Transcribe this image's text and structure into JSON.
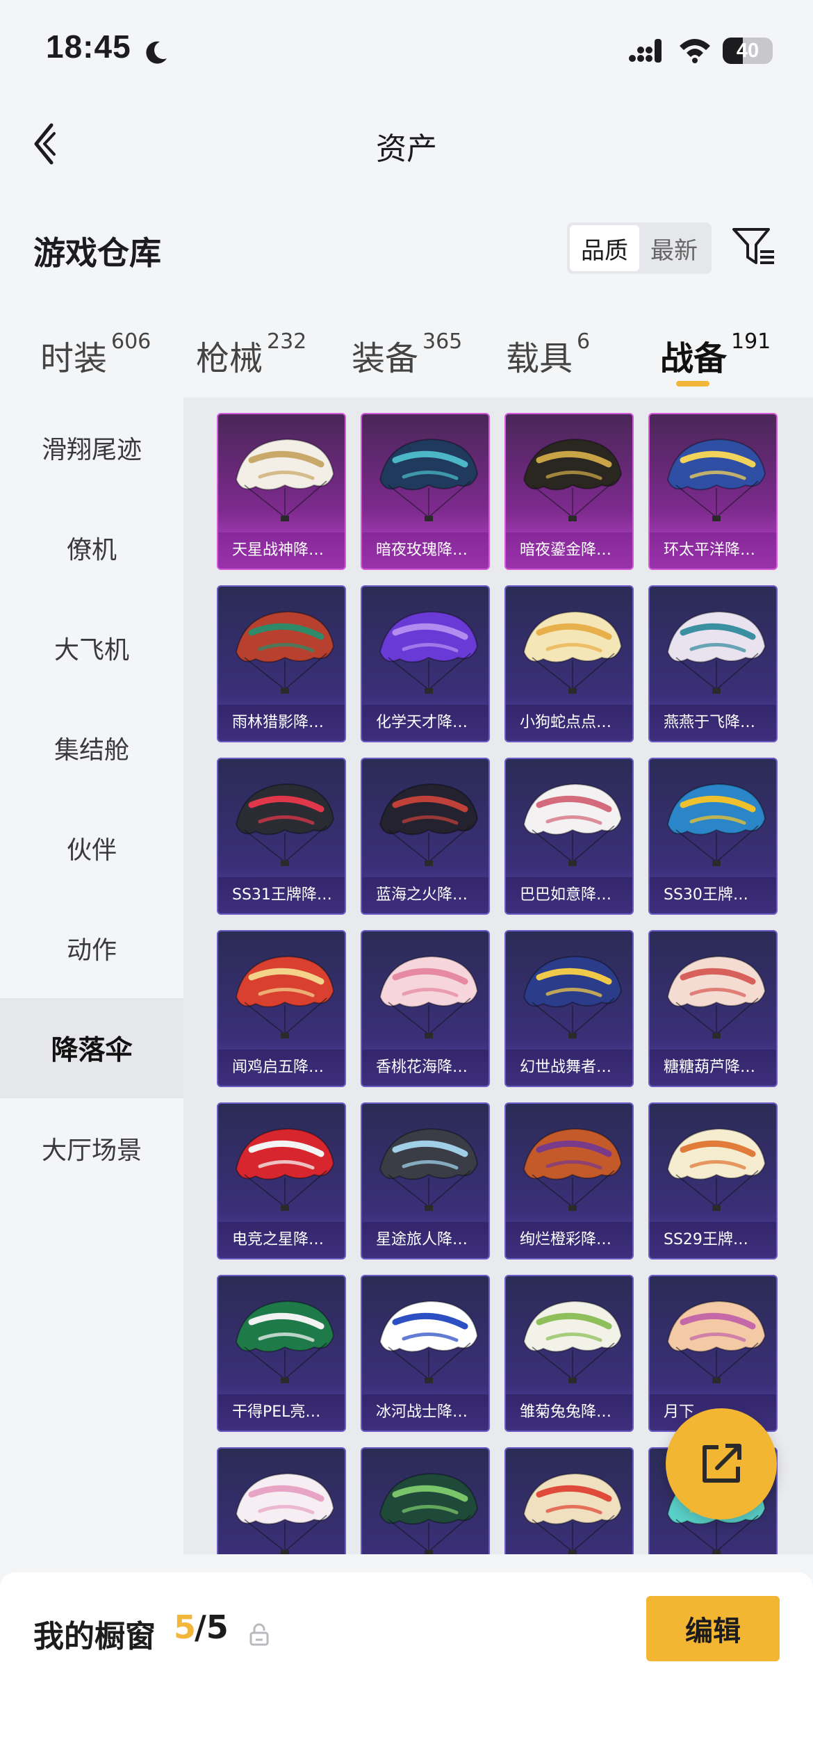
{
  "status_bar": {
    "time": "18:45",
    "battery": "40",
    "battery_level": 0.4,
    "icons": [
      "moon-icon",
      "signal-icon",
      "wifi-icon",
      "battery-icon"
    ]
  },
  "nav": {
    "title": "资产",
    "back_icon": "chevron-left-icon"
  },
  "header": {
    "heading": "游戏仓库",
    "sort_options": [
      "品质",
      "最新"
    ],
    "sort_selected": "品质",
    "filter_icon": "filter-icon"
  },
  "tabs": [
    {
      "label": "时装",
      "count": "606"
    },
    {
      "label": "枪械",
      "count": "232"
    },
    {
      "label": "装备",
      "count": "365"
    },
    {
      "label": "载具",
      "count": "6"
    },
    {
      "label": "战备",
      "count": "191",
      "active": true
    }
  ],
  "sidebar": {
    "items": [
      {
        "label": "滑翔尾迹"
      },
      {
        "label": "僚机"
      },
      {
        "label": "大飞机"
      },
      {
        "label": "集结舱"
      },
      {
        "label": "伙伴"
      },
      {
        "label": "动作"
      },
      {
        "label": "降落伞",
        "active": true
      },
      {
        "label": "大厅场景"
      }
    ]
  },
  "grid": {
    "items": [
      {
        "name": "天星战神降…",
        "rarity": "legendary",
        "colors": [
          "#f3efe6",
          "#c9a96a"
        ]
      },
      {
        "name": "暗夜玫瑰降…",
        "rarity": "legendary",
        "colors": [
          "#1f3a5c",
          "#4bb7c7"
        ]
      },
      {
        "name": "暗夜鎏金降…",
        "rarity": "legendary",
        "colors": [
          "#2a2620",
          "#c9a447"
        ]
      },
      {
        "name": "环太平洋降…",
        "rarity": "legendary",
        "colors": [
          "#2e4fa3",
          "#f1d25a"
        ]
      },
      {
        "name": "雨林猎影降…",
        "rarity": "epic",
        "colors": [
          "#b8402e",
          "#2f8a6a"
        ]
      },
      {
        "name": "化学天才降…",
        "rarity": "epic",
        "colors": [
          "#6a3ad6",
          "#b48cf0"
        ]
      },
      {
        "name": "小狗蛇点点…",
        "rarity": "epic",
        "colors": [
          "#f5e6b8",
          "#e8b04a"
        ]
      },
      {
        "name": "燕燕于飞降…",
        "rarity": "epic",
        "colors": [
          "#e9e2ef",
          "#3a8fa0"
        ]
      },
      {
        "name": "SS31王牌降…",
        "rarity": "epic",
        "colors": [
          "#2b2b33",
          "#e0384a"
        ]
      },
      {
        "name": "蓝海之火降…",
        "rarity": "epic",
        "colors": [
          "#23222e",
          "#c0403a"
        ]
      },
      {
        "name": "巴巴如意降…",
        "rarity": "epic",
        "colors": [
          "#f4f1f2",
          "#d46b7c"
        ]
      },
      {
        "name": "SS30王牌…",
        "rarity": "epic",
        "colors": [
          "#2a86c8",
          "#f0c12e"
        ]
      },
      {
        "name": "闻鸡启五降…",
        "rarity": "epic",
        "colors": [
          "#d9402f",
          "#f3d28a"
        ]
      },
      {
        "name": "香桃花海降…",
        "rarity": "epic",
        "colors": [
          "#f6d6dc",
          "#e58aa0"
        ]
      },
      {
        "name": "幻世战舞者…",
        "rarity": "epic",
        "colors": [
          "#2b3d8a",
          "#f0c84a"
        ]
      },
      {
        "name": "糖糖葫芦降…",
        "rarity": "epic",
        "colors": [
          "#f5dcd3",
          "#d8605a"
        ]
      },
      {
        "name": "电竞之星降…",
        "rarity": "epic",
        "colors": [
          "#d8262e",
          "#f4f4f4"
        ]
      },
      {
        "name": "星途旅人降…",
        "rarity": "epic",
        "colors": [
          "#3a3d46",
          "#9fd0e8"
        ]
      },
      {
        "name": "绚烂橙彩降…",
        "rarity": "epic",
        "colors": [
          "#c45a2a",
          "#7a3a8a"
        ]
      },
      {
        "name": "SS29王牌…",
        "rarity": "epic",
        "colors": [
          "#f6ecd0",
          "#e07b3a"
        ]
      },
      {
        "name": "干得PEL亮…",
        "rarity": "epic",
        "colors": [
          "#1f7a4a",
          "#f2f2f2"
        ]
      },
      {
        "name": "冰河战士降…",
        "rarity": "epic",
        "colors": [
          "#ffffff",
          "#2d4fc4"
        ]
      },
      {
        "name": "雏菊兔兔降…",
        "rarity": "epic",
        "colors": [
          "#f2f2e8",
          "#8fbf5a"
        ]
      },
      {
        "name": "月下…",
        "rarity": "epic",
        "colors": [
          "#f3c9a6",
          "#c468a8"
        ]
      },
      {
        "name": "",
        "rarity": "epic",
        "colors": [
          "#f6eef2",
          "#e8a4c4"
        ]
      },
      {
        "name": "",
        "rarity": "epic",
        "colors": [
          "#1f4a3a",
          "#7ac46a"
        ]
      },
      {
        "name": "",
        "rarity": "epic",
        "colors": [
          "#f0e0c0",
          "#e04a3a"
        ]
      },
      {
        "name": "",
        "rarity": "epic",
        "colors": [
          "#5ad0c8",
          "#f0d24a"
        ]
      }
    ]
  },
  "share_button": {
    "icon": "share-icon"
  },
  "bottom_bar": {
    "label": "我的橱窗",
    "count": "5",
    "total": "/5",
    "lock_icon": "lock-icon",
    "edit_label": "编辑"
  },
  "colors": {
    "accent": "#f3b633",
    "background": "#f4f5f7",
    "legendary_card": "#c24cd2",
    "epic_card": "#3b2f78"
  }
}
